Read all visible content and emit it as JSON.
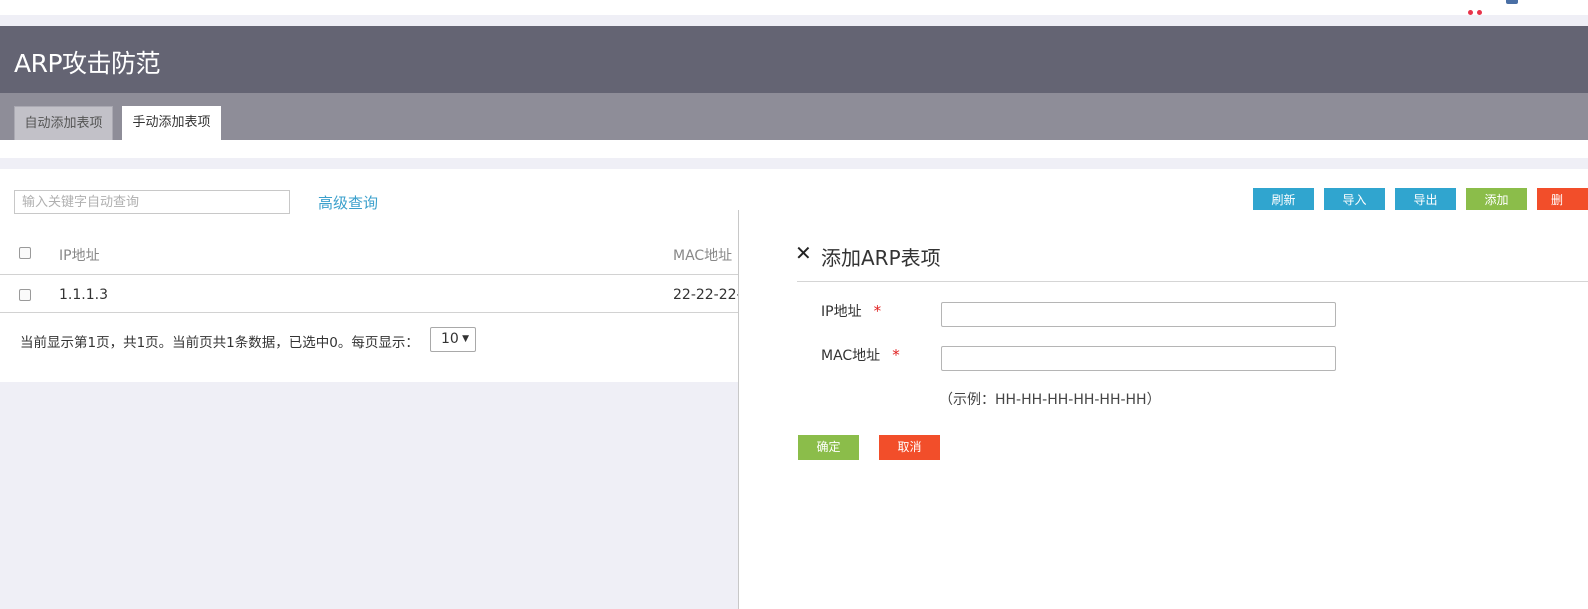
{
  "page": {
    "title": "ARP攻击防范"
  },
  "tabs": [
    {
      "label": "自动添加表项",
      "active": false
    },
    {
      "label": "手动添加表项",
      "active": true
    }
  ],
  "toolbar": {
    "search_placeholder": "输入关键字自动查询",
    "advanced_search": "高级查询",
    "refresh": "刷新",
    "import": "导入",
    "export": "导出",
    "add": "添加",
    "delete": "删"
  },
  "table": {
    "columns": [
      "IP地址",
      "MAC地址"
    ],
    "rows": [
      {
        "ip": "1.1.1.3",
        "mac": "22-22-22-"
      }
    ]
  },
  "pagination": {
    "summary": "当前显示第1页，共1页。当前页共1条数据，已选中0。每页显示：",
    "page_size": "10"
  },
  "dialog": {
    "title": "添加ARP表项",
    "ip_label": "IP地址",
    "mac_label": "MAC地址",
    "required_mark": "*",
    "mac_hint": "（示例：HH-HH-HH-HH-HH-HH）",
    "confirm": "确定",
    "cancel": "取消"
  },
  "colors": {
    "title_bar": "#646473",
    "tab_bar": "#8e8d98",
    "primary_button": "#30a5cf",
    "add_button": "#8bbd4a",
    "danger_button": "#f24e2a",
    "link": "#3ba0cc"
  }
}
